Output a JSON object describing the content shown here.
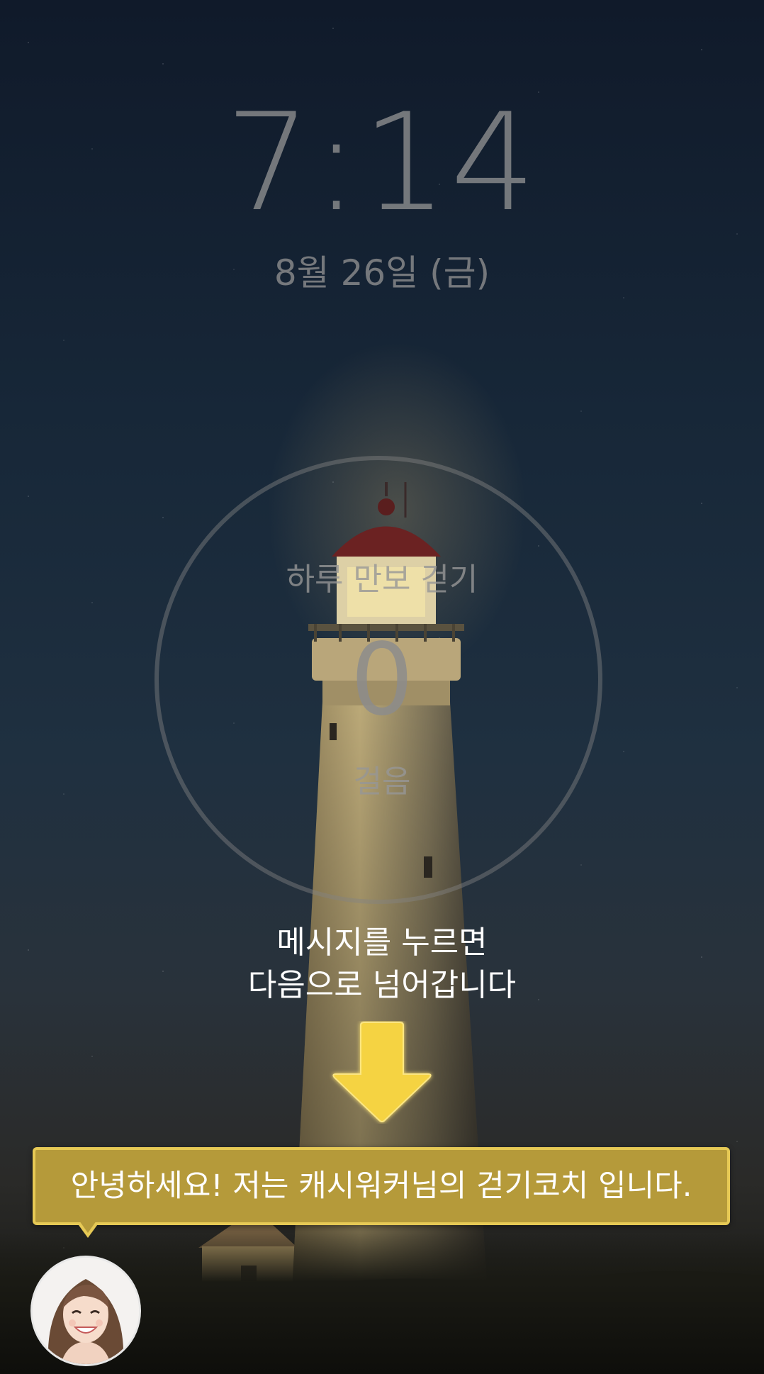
{
  "lockscreen": {
    "time": "7:14",
    "date": "8월 26일 (금)"
  },
  "steps_widget": {
    "title": "하루 만보 걷기",
    "count": "0",
    "unit": "걸음"
  },
  "hint": {
    "line1": "메시지를 누르면",
    "line2": "다음으로 넘어갑니다"
  },
  "coach": {
    "message": "안녕하세요! 저는 캐시워커님의 걷기코치 입니다.",
    "avatar_icon": "coach-avatar"
  },
  "colors": {
    "bubble_fill": "#b59a3a",
    "bubble_border": "#e6c955",
    "arrow": "#f5d343"
  }
}
